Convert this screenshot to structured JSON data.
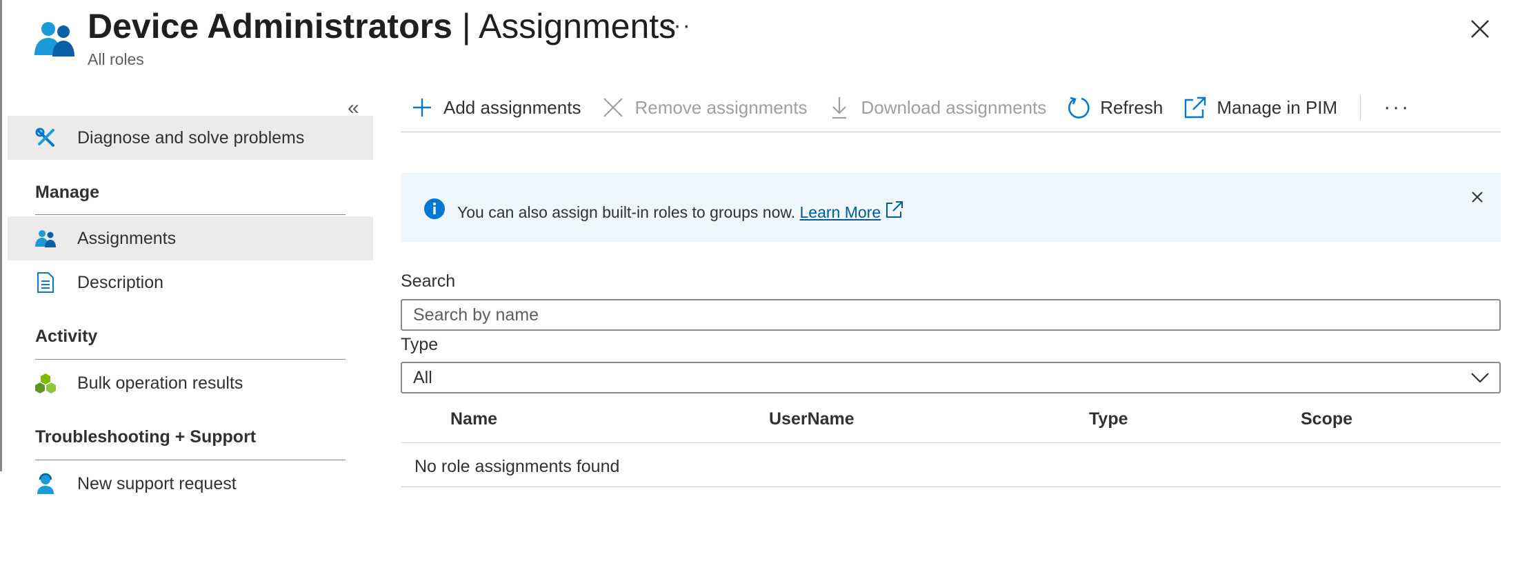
{
  "header": {
    "title_main": "Device Administrators",
    "title_separator": "|",
    "title_section": "Assignments",
    "subtitle": "All roles",
    "more_label": "···",
    "icon": "users-icon",
    "close_icon": "close-icon"
  },
  "sidebar": {
    "collapse_label": "«",
    "top_item": {
      "label": "Diagnose and solve problems",
      "icon": "wrench-screwdriver-icon"
    },
    "sections": [
      {
        "heading": "Manage",
        "items": [
          {
            "label": "Assignments",
            "icon": "users-icon",
            "selected": true
          },
          {
            "label": "Description",
            "icon": "document-icon",
            "selected": false
          }
        ]
      },
      {
        "heading": "Activity",
        "items": [
          {
            "label": "Bulk operation results",
            "icon": "cubes-icon",
            "selected": false
          }
        ]
      },
      {
        "heading": "Troubleshooting + Support",
        "items": [
          {
            "label": "New support request",
            "icon": "support-person-icon",
            "selected": false
          }
        ]
      }
    ]
  },
  "toolbar": {
    "add": "Add assignments",
    "remove": "Remove assignments",
    "download": "Download assignments",
    "refresh": "Refresh",
    "manage_pim": "Manage in PIM",
    "more": "···"
  },
  "banner": {
    "text": "You can also assign built-in roles to groups now.",
    "link": "Learn More",
    "icon": "info-icon"
  },
  "search": {
    "label": "Search",
    "placeholder": "Search by name",
    "value": ""
  },
  "type_filter": {
    "label": "Type",
    "selected": "All"
  },
  "table": {
    "columns": [
      "Name",
      "UserName",
      "Type",
      "Scope"
    ],
    "rows": [],
    "empty_message": "No role assignments found"
  },
  "colors": {
    "accent": "#0078d4",
    "selected_bg": "#edebe9",
    "banner_bg": "#eff6fc",
    "disabled_text": "#a19f9d"
  }
}
